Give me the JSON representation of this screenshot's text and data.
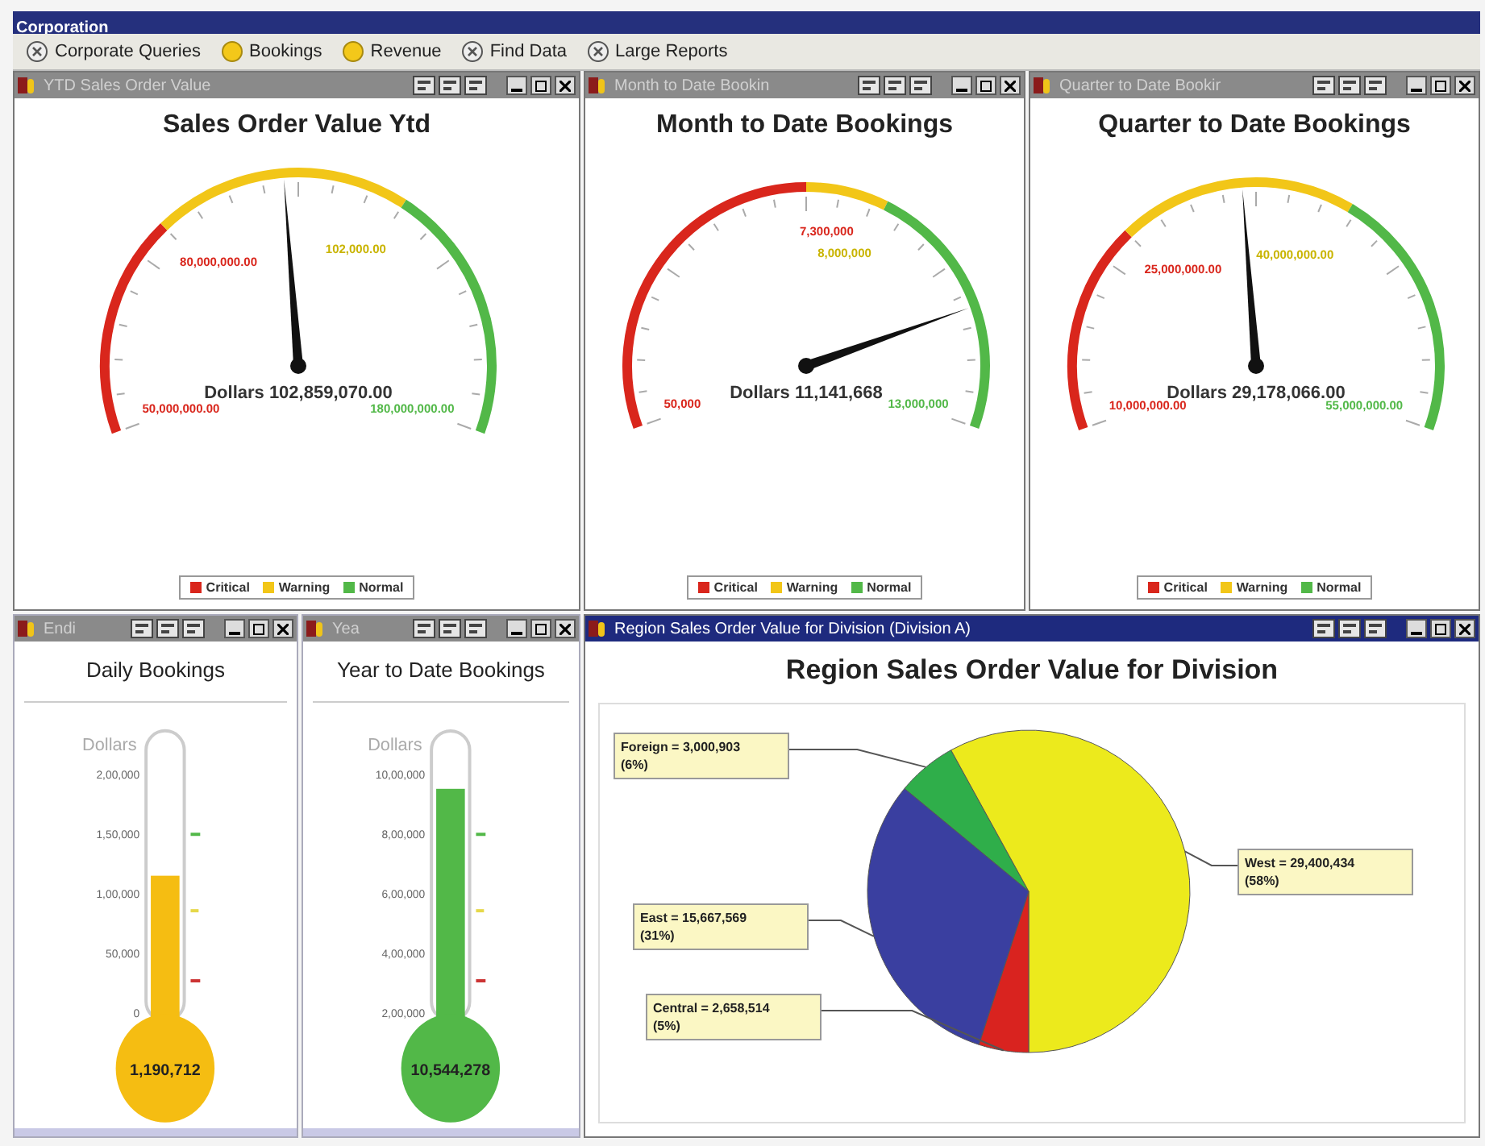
{
  "window": {
    "title": "Corporation"
  },
  "toolbar": [
    {
      "label": "Corporate Queries",
      "selected": false
    },
    {
      "label": "Bookings",
      "selected": true
    },
    {
      "label": "Revenue",
      "selected": true
    },
    {
      "label": "Find Data",
      "selected": false
    },
    {
      "label": "Large Reports",
      "selected": false
    }
  ],
  "gauges": [
    {
      "window_title": "YTD Sales Order Value",
      "active": false,
      "title": "Sales Order Value Ytd",
      "value_text": "Dollars 102,859,070.00",
      "bands": [
        {
          "color": "#d9261c"
        },
        {
          "color": "#f2c618"
        },
        {
          "color": "#52b848"
        }
      ],
      "scale_labels": [
        {
          "text": "50,000,000.00",
          "kind": "start"
        },
        {
          "text": "80,000,000.00",
          "kind": "critical"
        },
        {
          "text": "102,000.00",
          "kind": "warning"
        },
        {
          "text": "180,000,000.00",
          "kind": "end"
        }
      ],
      "legend": [
        {
          "label": "Critical",
          "color": "#d9261c"
        },
        {
          "label": "Warning",
          "color": "#f2c618"
        },
        {
          "label": "Normal",
          "color": "#52b848"
        }
      ]
    },
    {
      "window_title": "Month to Date Bookin",
      "active": false,
      "title": "Month to Date Bookings",
      "value_text": "Dollars 11,141,668",
      "bands": [
        {
          "color": "#d9261c"
        },
        {
          "color": "#f2c618"
        },
        {
          "color": "#52b848"
        }
      ],
      "scale_labels": [
        {
          "text": "50,000",
          "kind": "start"
        },
        {
          "text": "7,300,000",
          "kind": "critical"
        },
        {
          "text": "8,000,000",
          "kind": "warning"
        },
        {
          "text": "13,000,000",
          "kind": "end"
        }
      ],
      "legend": [
        {
          "label": "Critical",
          "color": "#d9261c"
        },
        {
          "label": "Warning",
          "color": "#f2c618"
        },
        {
          "label": "Normal",
          "color": "#52b848"
        }
      ]
    },
    {
      "window_title": "Quarter to Date Bookir",
      "active": false,
      "title": "Quarter to Date Bookings",
      "value_text": "Dollars 29,178,066.00",
      "bands": [
        {
          "color": "#d9261c"
        },
        {
          "color": "#f2c618"
        },
        {
          "color": "#52b848"
        }
      ],
      "scale_labels": [
        {
          "text": "10,000,000.00",
          "kind": "start"
        },
        {
          "text": "25,000,000.00",
          "kind": "critical"
        },
        {
          "text": "40,000,000.00",
          "kind": "warning"
        },
        {
          "text": "55,000,000.00",
          "kind": "end"
        }
      ],
      "legend": [
        {
          "label": "Critical",
          "color": "#d9261c"
        },
        {
          "label": "Warning",
          "color": "#f2c618"
        },
        {
          "label": "Normal",
          "color": "#52b848"
        }
      ]
    }
  ],
  "thermometers": [
    {
      "window_title": "Endi",
      "active": false,
      "title": "Daily Bookings",
      "axis_label": "Dollars",
      "ticks": [
        "2,00,000",
        "1,50,000",
        "1,00,000",
        "50,000",
        "0"
      ],
      "level": 0.5,
      "color": "#f5bd12",
      "reading": "1,190,712"
    },
    {
      "window_title": "Yea",
      "active": false,
      "title": "Year to Date Bookings",
      "axis_label": "Dollars",
      "ticks": [
        "10,00,000",
        "8,00,000",
        "6,00,000",
        "4,00,000",
        "2,00,000"
      ],
      "level": 0.8,
      "color": "#52b848",
      "reading": "10,544,278"
    }
  ],
  "pie_panel": {
    "window_title": "Region Sales Order Value for Division (Division A)",
    "active": true,
    "title": "Region Sales Order Value for Division",
    "chart_data": {
      "type": "pie",
      "values": [
        6,
        58,
        31,
        5
      ],
      "colors": [
        "#2fae4a",
        "#ecea1c",
        "#3a3fa0",
        "#d9231f"
      ],
      "annotations": [
        {
          "text": "Foreign = 3,000,903\n(6%)"
        },
        {
          "text": "West = 29,400,434\n(58%)"
        },
        {
          "text": "East = 15,667,569\n(31%)"
        },
        {
          "text": "Central = 2,658,514\n(5%)"
        }
      ]
    }
  }
}
